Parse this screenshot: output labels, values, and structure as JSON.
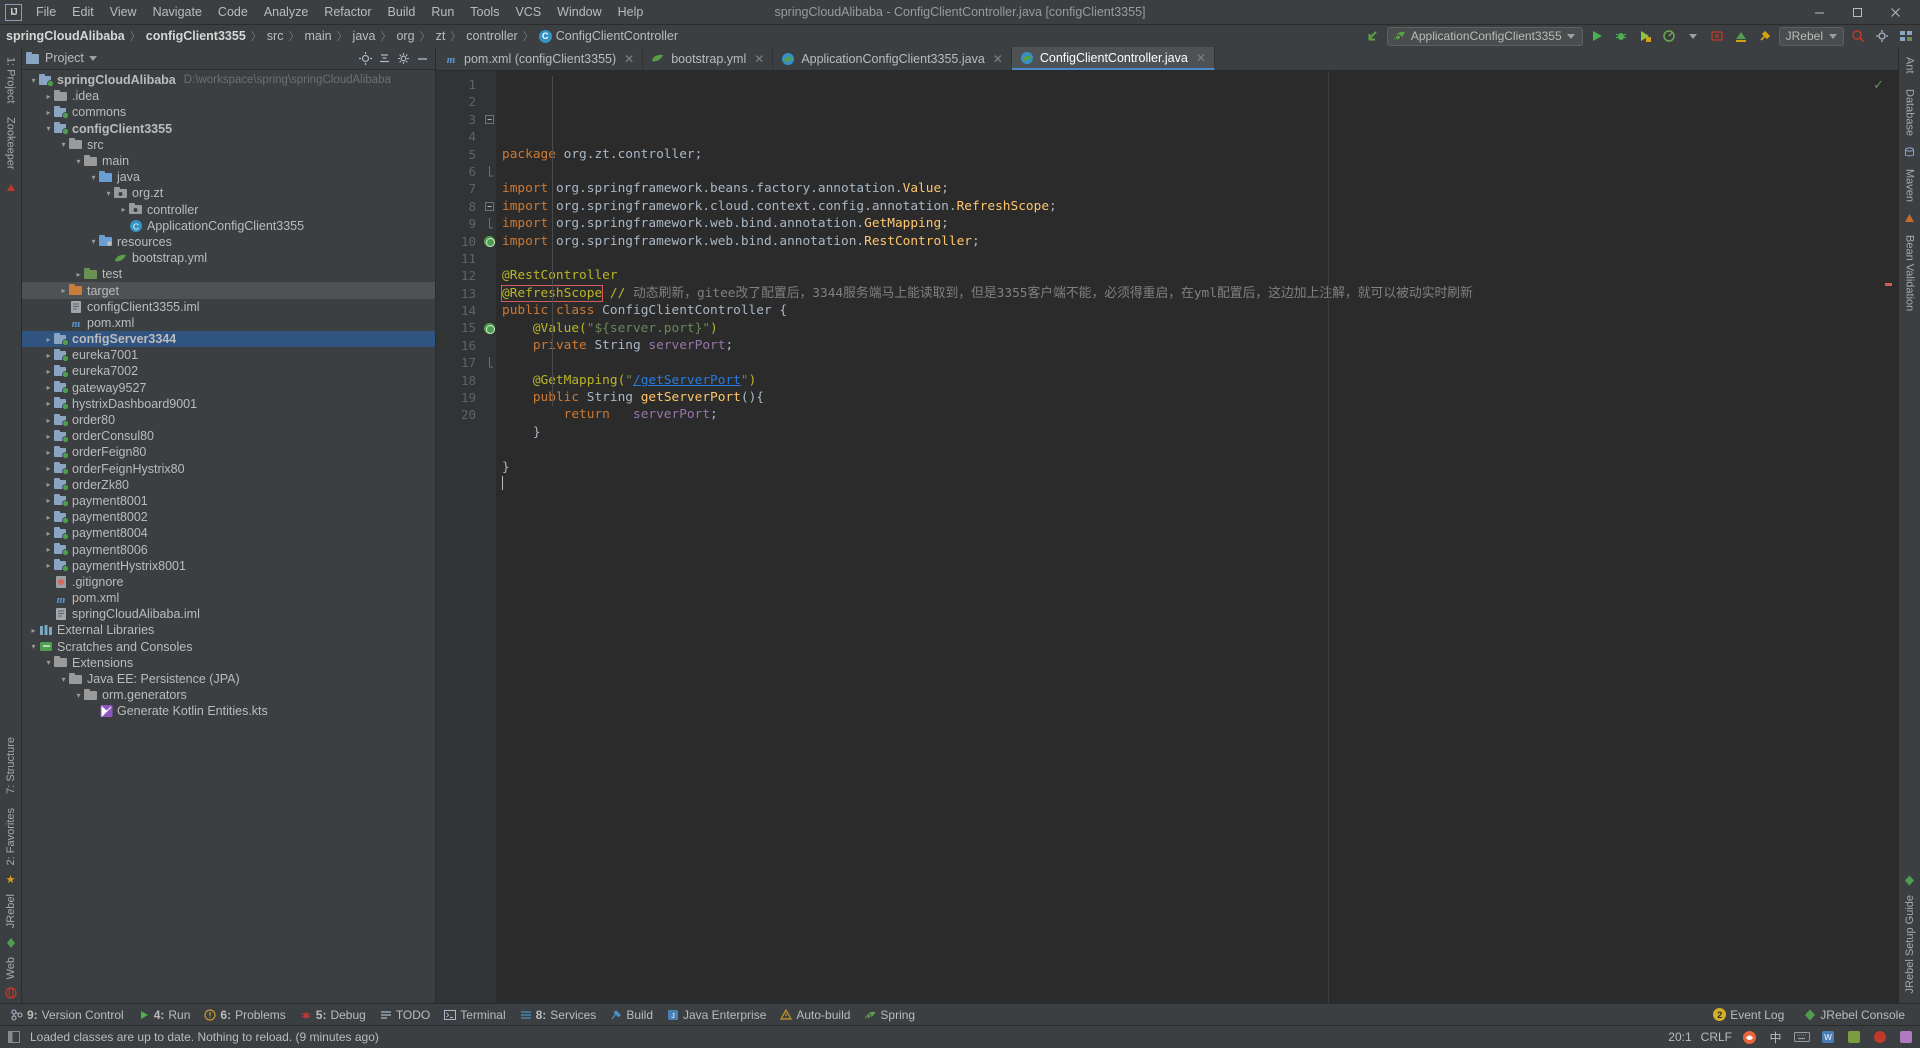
{
  "window": {
    "title": "springCloudAlibaba - ConfigClientController.java [configClient3355]",
    "minimize": "–",
    "maximize": "❐",
    "close": "✕"
  },
  "menu": [
    "File",
    "Edit",
    "View",
    "Navigate",
    "Code",
    "Analyze",
    "Refactor",
    "Build",
    "Run",
    "Tools",
    "VCS",
    "Window",
    "Help"
  ],
  "breadcrumb": [
    {
      "label": "springCloudAlibaba",
      "bold": true
    },
    {
      "label": "configClient3355",
      "bold": true
    },
    {
      "label": "src",
      "bold": false
    },
    {
      "label": "main",
      "bold": false
    },
    {
      "label": "java",
      "bold": false
    },
    {
      "label": "org",
      "bold": false
    },
    {
      "label": "zt",
      "bold": false
    },
    {
      "label": "controller",
      "bold": false
    },
    {
      "label": "ConfigClientController",
      "bold": false,
      "icon": "class-icon",
      "icon_letter": "C"
    }
  ],
  "toolbar": {
    "run_config": "ApplicationConfigClient3355",
    "jrebel_label": "JRebel",
    "icons": [
      "back-arrow-icon",
      "run-icon",
      "debug-icon",
      "run-coverage-icon",
      "profile-icon",
      "attach-icon",
      "build-icon",
      "search-everywhere-icon",
      "settings-icon",
      "project-structure-icon"
    ]
  },
  "project_panel": {
    "title": "Project",
    "actions": [
      "locate-icon",
      "collapse-all-icon",
      "settings-icon",
      "hide-icon"
    ],
    "tree": [
      {
        "depth": 0,
        "arrow": "down",
        "icon": "module-icon",
        "label": "springCloudAlibaba",
        "bold": true,
        "path": "D:\\workspace\\spring\\springCloudAlibaba",
        "state": "normal"
      },
      {
        "depth": 1,
        "arrow": "right",
        "icon": "folder-grey",
        "label": ".idea",
        "state": "normal"
      },
      {
        "depth": 1,
        "arrow": "right",
        "icon": "module-icon",
        "label": "commons",
        "state": "normal"
      },
      {
        "depth": 1,
        "arrow": "down",
        "icon": "module-icon",
        "label": "configClient3355",
        "bold": true,
        "state": "normal"
      },
      {
        "depth": 2,
        "arrow": "down",
        "icon": "folder-grey",
        "label": "src",
        "state": "normal"
      },
      {
        "depth": 3,
        "arrow": "down",
        "icon": "folder-grey",
        "label": "main",
        "state": "normal"
      },
      {
        "depth": 4,
        "arrow": "down",
        "icon": "folder-src",
        "label": "java",
        "state": "normal"
      },
      {
        "depth": 5,
        "arrow": "down",
        "icon": "package-icon",
        "label": "org.zt",
        "state": "normal"
      },
      {
        "depth": 6,
        "arrow": "right",
        "icon": "package-icon",
        "label": "controller",
        "state": "normal"
      },
      {
        "depth": 6,
        "arrow": "none",
        "icon": "java-class-icon",
        "label": "ApplicationConfigClient3355",
        "state": "normal"
      },
      {
        "depth": 4,
        "arrow": "down",
        "icon": "folder-resources",
        "label": "resources",
        "state": "normal"
      },
      {
        "depth": 5,
        "arrow": "none",
        "icon": "yml-icon",
        "label": "bootstrap.yml",
        "state": "normal"
      },
      {
        "depth": 3,
        "arrow": "right",
        "icon": "folder-test",
        "label": "test",
        "state": "normal"
      },
      {
        "depth": 2,
        "arrow": "right",
        "icon": "folder-target",
        "label": "target",
        "state": "selected-grey"
      },
      {
        "depth": 2,
        "arrow": "none",
        "icon": "iml-icon",
        "label": "configClient3355.iml",
        "state": "normal"
      },
      {
        "depth": 2,
        "arrow": "none",
        "icon": "xml-icon",
        "label": "pom.xml",
        "state": "normal"
      },
      {
        "depth": 1,
        "arrow": "right",
        "icon": "module-icon",
        "label": "configServer3344",
        "bold": true,
        "state": "selected-blue"
      },
      {
        "depth": 1,
        "arrow": "right",
        "icon": "module-icon",
        "label": "eureka7001",
        "state": "normal"
      },
      {
        "depth": 1,
        "arrow": "right",
        "icon": "module-icon",
        "label": "eureka7002",
        "state": "normal"
      },
      {
        "depth": 1,
        "arrow": "right",
        "icon": "module-icon",
        "label": "gateway9527",
        "state": "normal"
      },
      {
        "depth": 1,
        "arrow": "right",
        "icon": "module-icon",
        "label": "hystrixDashboard9001",
        "state": "normal"
      },
      {
        "depth": 1,
        "arrow": "right",
        "icon": "module-icon",
        "label": "order80",
        "state": "normal"
      },
      {
        "depth": 1,
        "arrow": "right",
        "icon": "module-icon",
        "label": "orderConsul80",
        "state": "normal"
      },
      {
        "depth": 1,
        "arrow": "right",
        "icon": "module-icon",
        "label": "orderFeign80",
        "state": "normal"
      },
      {
        "depth": 1,
        "arrow": "right",
        "icon": "module-icon",
        "label": "orderFeignHystrix80",
        "state": "normal"
      },
      {
        "depth": 1,
        "arrow": "right",
        "icon": "module-icon",
        "label": "orderZk80",
        "state": "normal"
      },
      {
        "depth": 1,
        "arrow": "right",
        "icon": "module-icon",
        "label": "payment8001",
        "state": "normal"
      },
      {
        "depth": 1,
        "arrow": "right",
        "icon": "module-icon",
        "label": "payment8002",
        "state": "normal"
      },
      {
        "depth": 1,
        "arrow": "right",
        "icon": "module-icon",
        "label": "payment8004",
        "state": "normal"
      },
      {
        "depth": 1,
        "arrow": "right",
        "icon": "module-icon",
        "label": "payment8006",
        "state": "normal"
      },
      {
        "depth": 1,
        "arrow": "right",
        "icon": "module-icon",
        "label": "paymentHystrix8001",
        "state": "normal"
      },
      {
        "depth": 1,
        "arrow": "none",
        "icon": "gitignore-icon",
        "label": ".gitignore",
        "state": "normal"
      },
      {
        "depth": 1,
        "arrow": "none",
        "icon": "xml-icon",
        "label": "pom.xml",
        "state": "normal"
      },
      {
        "depth": 1,
        "arrow": "none",
        "icon": "iml-icon",
        "label": "springCloudAlibaba.iml",
        "state": "normal"
      },
      {
        "depth": 0,
        "arrow": "right",
        "icon": "library-icon",
        "label": "External Libraries",
        "state": "normal"
      },
      {
        "depth": 0,
        "arrow": "down",
        "icon": "scratches-icon",
        "label": "Scratches and Consoles",
        "state": "normal"
      },
      {
        "depth": 1,
        "arrow": "down",
        "icon": "folder-grey",
        "label": "Extensions",
        "state": "normal"
      },
      {
        "depth": 2,
        "arrow": "down",
        "icon": "folder-grey",
        "label": "Java EE: Persistence (JPA)",
        "state": "normal"
      },
      {
        "depth": 3,
        "arrow": "down",
        "icon": "folder-grey",
        "label": "orm.generators",
        "state": "normal"
      },
      {
        "depth": 4,
        "arrow": "none",
        "icon": "kotlin-icon",
        "label": "Generate Kotlin Entities.kts",
        "state": "normal"
      }
    ]
  },
  "editor": {
    "tabs": [
      {
        "label": "pom.xml (configClient3355)",
        "icon": "maven-icon",
        "active": false,
        "closable": true
      },
      {
        "label": "bootstrap.yml",
        "icon": "yml-icon",
        "active": false,
        "closable": true
      },
      {
        "label": "ApplicationConfigClient3355.java",
        "icon": "spring-class-icon",
        "active": false,
        "closable": true
      },
      {
        "label": "ConfigClientController.java",
        "icon": "spring-class-icon",
        "active": true,
        "closable": true
      }
    ],
    "line_numbers": [
      "1",
      "2",
      "3",
      "4",
      "5",
      "6",
      "7",
      "8",
      "9",
      "10",
      "11",
      "12",
      "13",
      "14",
      "15",
      "16",
      "17",
      "18",
      "19",
      "20"
    ],
    "code_lines": [
      {
        "n": 1,
        "tokens": [
          {
            "t": "package ",
            "c": "kw"
          },
          {
            "t": "org.zt.controller;",
            "c": "cls"
          }
        ]
      },
      {
        "n": 2,
        "tokens": []
      },
      {
        "n": 3,
        "tokens": [
          {
            "t": "import ",
            "c": "kw"
          },
          {
            "t": "org.springframework.beans.factory.annotation.",
            "c": "cls"
          },
          {
            "t": "Value",
            "c": "typ"
          },
          {
            "t": ";",
            "c": "cls"
          }
        ],
        "fold": "minus"
      },
      {
        "n": 4,
        "tokens": [
          {
            "t": "import ",
            "c": "kw"
          },
          {
            "t": "org.springframework.cloud.context.config.annotation.",
            "c": "cls"
          },
          {
            "t": "RefreshScope",
            "c": "typ"
          },
          {
            "t": ";",
            "c": "cls"
          }
        ]
      },
      {
        "n": 5,
        "tokens": [
          {
            "t": "import ",
            "c": "kw"
          },
          {
            "t": "org.springframework.web.bind.annotation.",
            "c": "cls"
          },
          {
            "t": "GetMapping",
            "c": "typ"
          },
          {
            "t": ";",
            "c": "cls"
          }
        ]
      },
      {
        "n": 6,
        "tokens": [
          {
            "t": "import ",
            "c": "kw"
          },
          {
            "t": "org.springframework.web.bind.annotation.",
            "c": "cls"
          },
          {
            "t": "RestController",
            "c": "typ"
          },
          {
            "t": ";",
            "c": "cls"
          }
        ],
        "fold": "end"
      },
      {
        "n": 7,
        "tokens": []
      },
      {
        "n": 8,
        "tokens": [
          {
            "t": "@RestController",
            "c": "ann"
          }
        ],
        "fold": "minus"
      },
      {
        "n": 9,
        "tokens": [
          {
            "t": "@RefreshScope",
            "c": "ann",
            "box": true
          },
          {
            "t": " // ",
            "c": "ann"
          },
          {
            "t": "动态刷新，gitee改了配置后，3344服务端马上能读取到，但是3355客户端不能，必须得重启，在yml配置后，这边加上注解，就可以被动实时刷新",
            "c": "cmt"
          }
        ],
        "fold": "end"
      },
      {
        "n": 10,
        "tokens": [
          {
            "t": "public ",
            "c": "kw"
          },
          {
            "t": "class ",
            "c": "kw"
          },
          {
            "t": "ConfigClientController",
            "c": "cls"
          },
          {
            "t": " {",
            "c": "cls"
          }
        ],
        "mark": "bean"
      },
      {
        "n": 11,
        "tokens": [
          {
            "t": "    @Value(",
            "c": "ann"
          },
          {
            "t": "\"${server.port}\"",
            "c": "str"
          },
          {
            "t": ")",
            "c": "ann"
          }
        ]
      },
      {
        "n": 12,
        "tokens": [
          {
            "t": "    ",
            "c": "cls"
          },
          {
            "t": "private ",
            "c": "kw"
          },
          {
            "t": "String ",
            "c": "cls"
          },
          {
            "t": "serverPort",
            "c": "fld"
          },
          {
            "t": ";",
            "c": "cls"
          }
        ]
      },
      {
        "n": 13,
        "tokens": []
      },
      {
        "n": 14,
        "tokens": [
          {
            "t": "    @GetMapping(",
            "c": "ann"
          },
          {
            "t": "\"",
            "c": "str"
          },
          {
            "t": "/getServerPort",
            "c": "url"
          },
          {
            "t": "\"",
            "c": "str"
          },
          {
            "t": ")",
            "c": "ann"
          }
        ]
      },
      {
        "n": 15,
        "tokens": [
          {
            "t": "    ",
            "c": "cls"
          },
          {
            "t": "public ",
            "c": "kw"
          },
          {
            "t": "String ",
            "c": "cls"
          },
          {
            "t": "getServerPort",
            "c": "typ"
          },
          {
            "t": "(){",
            "c": "cls"
          }
        ],
        "mark": "bean",
        "fold": "minus"
      },
      {
        "n": 16,
        "tokens": [
          {
            "t": "        ",
            "c": "cls"
          },
          {
            "t": "return ",
            "c": "kw"
          },
          {
            "t": "  serverPort",
            "c": "fld"
          },
          {
            "t": ";",
            "c": "cls"
          }
        ]
      },
      {
        "n": 17,
        "tokens": [
          {
            "t": "    }",
            "c": "cls"
          }
        ],
        "fold": "end"
      },
      {
        "n": 18,
        "tokens": []
      },
      {
        "n": 19,
        "tokens": [
          {
            "t": "}",
            "c": "cls"
          }
        ]
      },
      {
        "n": 20,
        "tokens": [],
        "caret": true
      }
    ],
    "inspection_ok": "✓"
  },
  "left_rail": {
    "top": [
      "1: Project"
    ],
    "bottom": [
      "7: Structure",
      "2: Favorites",
      "JRebel",
      "Web"
    ],
    "extra": [
      "Zookeeper"
    ]
  },
  "right_rail": [
    "Ant",
    "Database",
    "Maven",
    "Bean Validation",
    "JRebel Setup Guide"
  ],
  "tool_windows": [
    {
      "num": "9",
      "label": "Version Control",
      "icon": "vcs-icon"
    },
    {
      "num": "4",
      "label": "Run",
      "icon": "run-icon"
    },
    {
      "num": "6",
      "label": "Problems",
      "icon": "problems-icon"
    },
    {
      "num": "5",
      "label": "Debug",
      "icon": "debug-icon"
    },
    {
      "num": "",
      "label": "TODO",
      "icon": "todo-icon"
    },
    {
      "num": "",
      "label": "Terminal",
      "icon": "terminal-icon"
    },
    {
      "num": "8",
      "label": "Services",
      "icon": "services-icon"
    },
    {
      "num": "",
      "label": "Build",
      "icon": "build-icon"
    },
    {
      "num": "",
      "label": "Java Enterprise",
      "icon": "jee-icon"
    },
    {
      "num": "",
      "label": "Auto-build",
      "icon": "autobuild-icon"
    },
    {
      "num": "",
      "label": "Spring",
      "icon": "spring-icon"
    }
  ],
  "tool_windows_right": [
    {
      "label": "Event Log",
      "badge": "2",
      "icon": "event-log-icon"
    },
    {
      "label": "JRebel Console",
      "badge": "",
      "icon": "jrebel-icon"
    }
  ],
  "statusbar": {
    "message": "Loaded classes are up to date. Nothing to reload. (9 minutes ago)",
    "caret_position": "20:1",
    "line_separator": "CRLF",
    "ime": "中",
    "tray_icons": [
      "ime-icon",
      "sogou-icon",
      "keyboard-icon",
      "tray-icon-1",
      "tray-icon-2",
      "tray-icon-3"
    ]
  },
  "colors": {
    "bg_panel": "#3c3f41",
    "bg_editor": "#2b2b2b",
    "accent_blue": "#3592c4",
    "select_blue": "#2f5480",
    "annotation": "#bbb529",
    "keyword": "#cc7832",
    "string": "#6a8759",
    "comment": "#808080",
    "error_red": "#d45b5b",
    "green": "#4f9e4f"
  }
}
